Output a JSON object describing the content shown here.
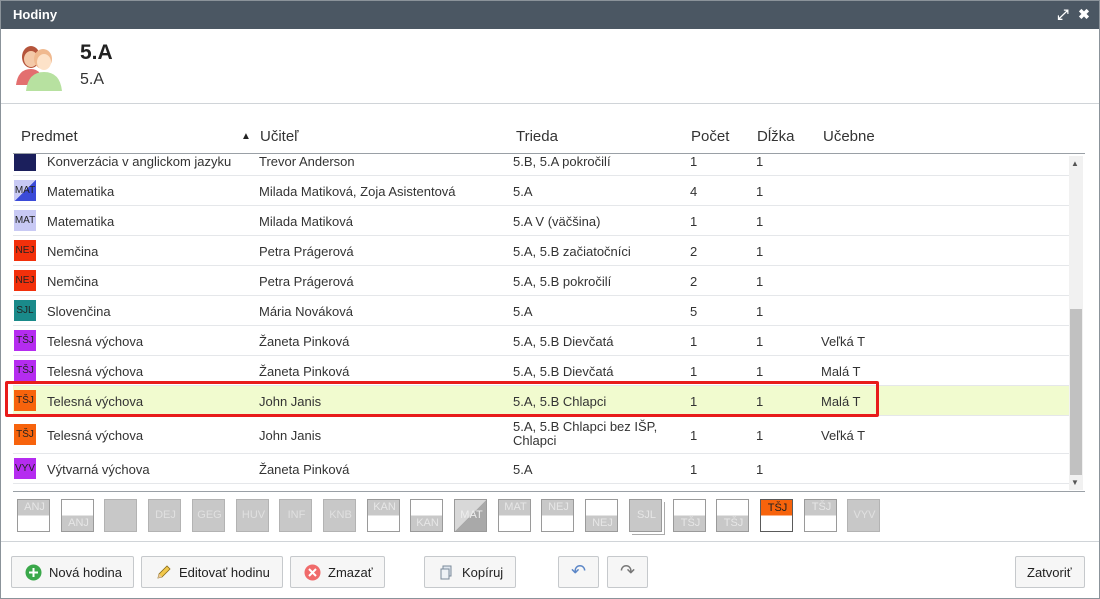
{
  "window": {
    "title": "Hodiny",
    "restore_glyph": "⤢",
    "close_glyph": "✖"
  },
  "header": {
    "title": "5.A",
    "subtitle": "5.A"
  },
  "columns": {
    "subject": "Predmet",
    "sort_glyph": "▲",
    "teacher": "Učiteľ",
    "class": "Trieda",
    "count": "Počet",
    "length": "Dĺžka",
    "rooms": "Učebne"
  },
  "rows": [
    {
      "badge": "",
      "badge_color": "#1b1f5c",
      "badge_split": false,
      "subject": "Konverzácia v anglickom jazyku",
      "teacher": "Trevor Anderson",
      "class": "5.B, 5.A pokročilí",
      "count": "1",
      "length": "1",
      "rooms": ""
    },
    {
      "badge": "MAT",
      "badge_color": "#3b4bd8",
      "badge_split": true,
      "subject": "Matematika",
      "teacher": "Milada Matiková, Zoja Asistentová",
      "class": "5.A",
      "count": "4",
      "length": "1",
      "rooms": ""
    },
    {
      "badge": "MAT",
      "badge_color": "#c8c9f4",
      "badge_split": false,
      "subject": "Matematika",
      "teacher": "Milada Matiková",
      "class": "5.A V (väčšina)",
      "count": "1",
      "length": "1",
      "rooms": ""
    },
    {
      "badge": "NEJ",
      "badge_color": "#f2300b",
      "badge_split": false,
      "subject": "Nemčina",
      "teacher": "Petra Prágerová",
      "class": "5.A, 5.B začiatočníci",
      "count": "2",
      "length": "1",
      "rooms": ""
    },
    {
      "badge": "NEJ",
      "badge_color": "#f2300b",
      "badge_split": false,
      "subject": "Nemčina",
      "teacher": "Petra Prágerová",
      "class": "5.A, 5.B pokročilí",
      "count": "2",
      "length": "1",
      "rooms": ""
    },
    {
      "badge": "SJL",
      "badge_color": "#1a8a8a",
      "badge_split": false,
      "subject": "Slovenčina",
      "teacher": "Mária Nováková",
      "class": "5.A",
      "count": "5",
      "length": "1",
      "rooms": ""
    },
    {
      "badge": "TŠJ",
      "badge_color": "#b52cf0",
      "badge_split": false,
      "subject": "Telesná výchova",
      "teacher": "Žaneta Pinková",
      "class": "5.A, 5.B Dievčatá",
      "count": "1",
      "length": "1",
      "rooms": "Veľká T"
    },
    {
      "badge": "TŠJ",
      "badge_color": "#b52cf0",
      "badge_split": false,
      "subject": "Telesná výchova",
      "teacher": "Žaneta Pinková",
      "class": "5.A, 5.B Dievčatá",
      "count": "1",
      "length": "1",
      "rooms": "Malá T"
    },
    {
      "badge": "TŠJ",
      "badge_color": "#f7630c",
      "badge_split": false,
      "subject": "Telesná výchova",
      "teacher": "John Janis",
      "class": "5.A, 5.B Chlapci",
      "count": "1",
      "length": "1",
      "rooms": "Malá T",
      "selected": true
    },
    {
      "badge": "TŠJ",
      "badge_color": "#f7630c",
      "badge_split": false,
      "subject": "Telesná výchova",
      "teacher": "John Janis",
      "class": "5.A, 5.B Chlapci bez IŠP, Chlapci",
      "count": "1",
      "length": "1",
      "rooms": "Veľká T",
      "tall": true
    },
    {
      "badge": "VYV",
      "badge_color": "#b52cf0",
      "badge_split": false,
      "subject": "Výtvarná výchova",
      "teacher": "Žaneta Pinková",
      "class": "5.A",
      "count": "1",
      "length": "1",
      "rooms": ""
    }
  ],
  "chips": [
    {
      "label": "ANJ",
      "style": "top"
    },
    {
      "label": "ANJ",
      "style": "bottom"
    },
    {
      "label": "",
      "style": "full"
    },
    {
      "label": "DEJ",
      "style": "full"
    },
    {
      "label": "GEG",
      "style": "full"
    },
    {
      "label": "HUV",
      "style": "full"
    },
    {
      "label": "INF",
      "style": "full"
    },
    {
      "label": "KNB",
      "style": "full"
    },
    {
      "label": "KAN",
      "style": "top"
    },
    {
      "label": "KAN",
      "style": "bottom"
    },
    {
      "label": "MAT",
      "style": "diag"
    },
    {
      "label": "MAT",
      "style": "top"
    },
    {
      "label": "NEJ",
      "style": "top"
    },
    {
      "label": "NEJ",
      "style": "bottom"
    },
    {
      "label": "SJL",
      "style": "stack"
    },
    {
      "label": "TŠJ",
      "style": "bottom"
    },
    {
      "label": "TŠJ",
      "style": "bottom"
    },
    {
      "label": "TŠJ",
      "style": "active"
    },
    {
      "label": "TŠJ",
      "style": "top"
    },
    {
      "label": "VYV",
      "style": "full"
    }
  ],
  "footer": {
    "new": "Nová hodina",
    "edit": "Editovať hodinu",
    "delete": "Zmazať",
    "copy": "Kopíruj",
    "undo_glyph": "↶",
    "redo_glyph": "↷",
    "close": "Zatvoriť"
  }
}
